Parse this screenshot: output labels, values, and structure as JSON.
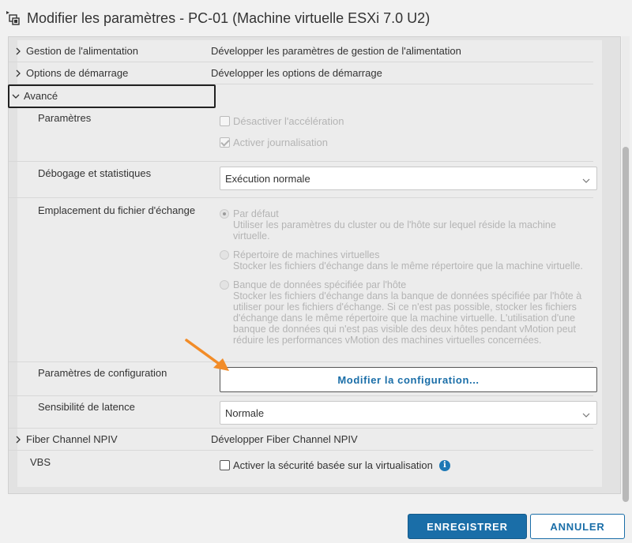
{
  "window": {
    "title": "Modifier les paramètres - PC-01 (Machine virtuelle ESXi 7.0 U2)"
  },
  "rows": {
    "power": {
      "label": "Gestion de l'alimentation",
      "value": "Développer les paramètres de gestion de l'alimentation"
    },
    "boot": {
      "label": "Options de démarrage",
      "value": "Développer les options de démarrage"
    },
    "advanced": {
      "label": "Avancé"
    },
    "settings": {
      "label": "Paramètres",
      "disable_accel": "Désactiver l'accélération",
      "enable_logging": "Activer journalisation"
    },
    "debug": {
      "label": "Débogage et statistiques",
      "selected": "Exécution normale"
    },
    "swap": {
      "label": "Emplacement du fichier d'échange",
      "options": [
        {
          "title": "Par défaut",
          "desc": "Utiliser les paramètres du cluster ou de l'hôte sur lequel réside la machine virtuelle."
        },
        {
          "title": "Répertoire de machines virtuelles",
          "desc": "Stocker les fichiers d'échange dans le même répertoire que la machine virtuelle."
        },
        {
          "title": "Banque de données spécifiée par l'hôte",
          "desc": "Stocker les fichiers d'échange dans la banque de données spécifiée par l'hôte à utiliser pour les fichiers d'échange. Si ce n'est pas possible, stocker les fichiers d'échange dans le même répertoire que la machine virtuelle. L'utilisation d'une banque de données qui n'est pas visible des deux hôtes pendant vMotion peut réduire les performances vMotion des machines virtuelles concernées."
        }
      ]
    },
    "config": {
      "label": "Paramètres de configuration",
      "button": "Modifier la configuration..."
    },
    "latency": {
      "label": "Sensibilité de latence",
      "selected": "Normale"
    },
    "npiv": {
      "label": "Fiber Channel NPIV",
      "value": "Développer Fiber Channel NPIV"
    },
    "vbs": {
      "label": "VBS",
      "checkbox": "Activer la sécurité basée sur la virtualisation"
    }
  },
  "footer": {
    "save": "ENREGISTRER",
    "cancel": "ANNULER"
  },
  "colors": {
    "accent": "#1a6ea8",
    "arrow": "#f28c28"
  }
}
